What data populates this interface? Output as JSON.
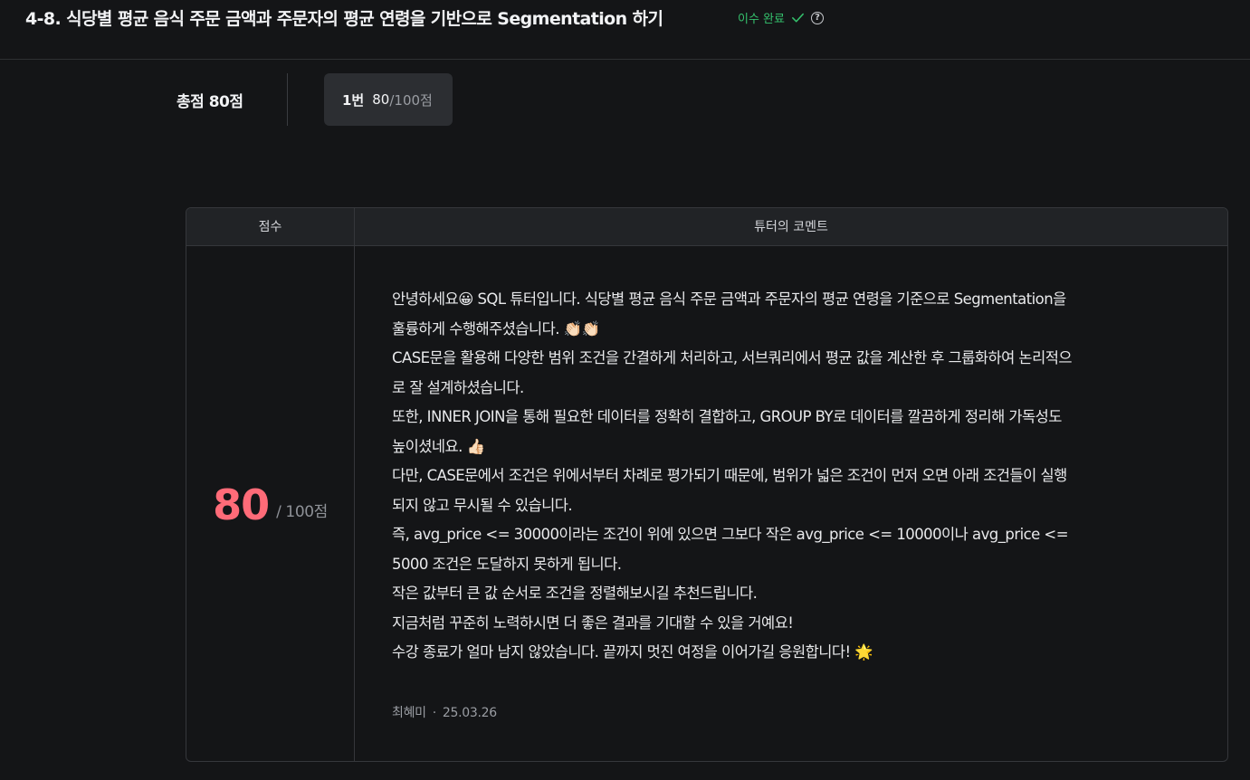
{
  "header": {
    "title": "4-8. 식당별 평균 음식 주문 금액과 주문자의 평균 연령을 기반으로 Segmentation 하기",
    "status": "이수 완료",
    "status_color": "#35c26d",
    "icons": [
      "check-icon",
      "help-icon"
    ]
  },
  "summary": {
    "total_label": "총점 80점",
    "tab": {
      "number": "1번",
      "score": "80",
      "max": "/100점"
    }
  },
  "table": {
    "headers": {
      "score": "점수",
      "comment": "튜터의 코멘트"
    },
    "score": {
      "value": "80",
      "max": "/ 100점",
      "color": "#ff6b78"
    },
    "comment_lines": [
      "안녕하세요😀 SQL 튜터입니다. 식당별 평균 음식 주문 금액과 주문자의 평균 연령을 기준으로 Segmentation을",
      "훌륭하게 수행해주셨습니다. 👏🏻👏🏻",
      "CASE문을 활용해 다양한 범위 조건을 간결하게 처리하고, 서브쿼리에서 평균 값을 계산한 후 그룹화하여 논리적으",
      "로 잘 설계하셨습니다.",
      "또한, INNER JOIN을 통해 필요한 데이터를 정확히 결합하고, GROUP BY로 데이터를 깔끔하게 정리해 가독성도",
      "높이셨네요. 👍🏻",
      "다만, CASE문에서 조건은 위에서부터 차례로 평가되기 때문에, 범위가 넓은 조건이 먼저 오면 아래 조건들이 실행",
      "되지 않고 무시될 수 있습니다.",
      "즉, avg_price <= 30000이라는 조건이 위에 있으면 그보다 작은 avg_price <= 10000이나 avg_price <=",
      "5000 조건은 도달하지 못하게 됩니다.",
      "작은 값부터 큰 값 순서로 조건을 정렬해보시길 추천드립니다.",
      "지금처럼 꾸준히 노력하시면 더 좋은 결과를 기대할 수 있을 거예요!",
      "수강 종료가 얼마 남지 않았습니다. 끝까지 멋진 여정을 이어가길 응원합니다! 🌟"
    ],
    "author": "최혜미",
    "date": "25.03.26"
  }
}
